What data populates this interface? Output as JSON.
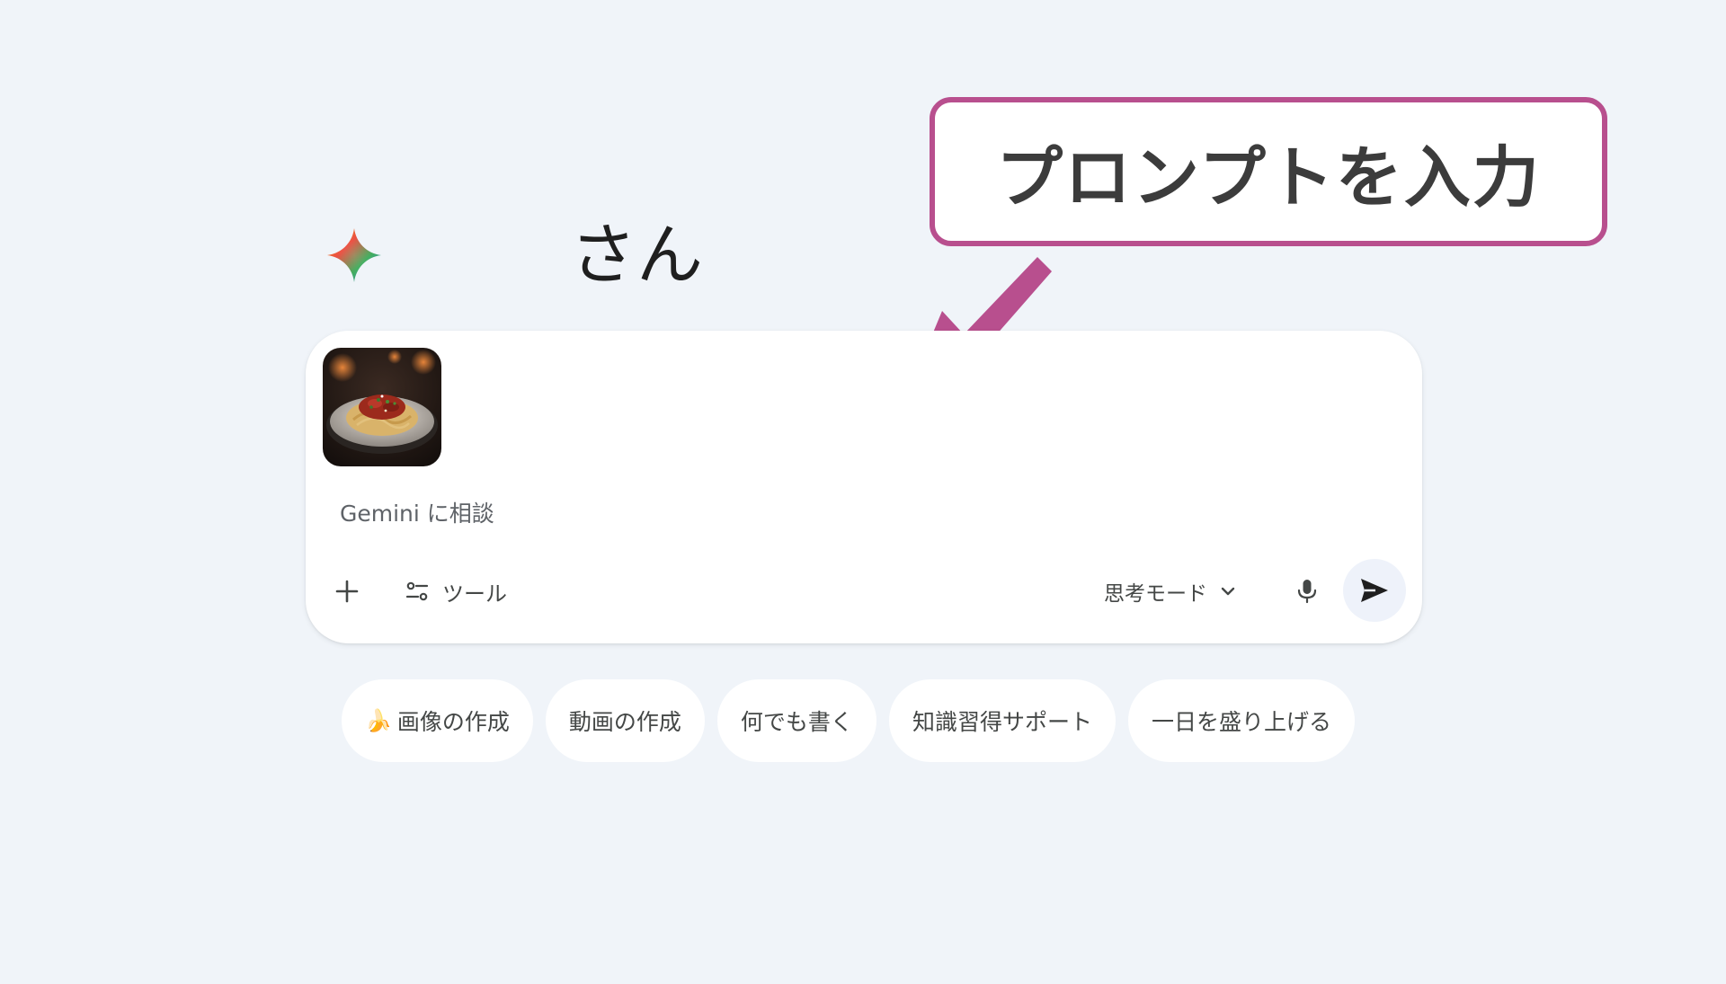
{
  "greeting": {
    "text": "さん"
  },
  "callout": {
    "text": "プロンプトを入力"
  },
  "prompt": {
    "placeholder": "Gemini に相談",
    "tools_label": "ツール",
    "mode_label": "思考モード"
  },
  "chips": [
    {
      "emoji": "🍌",
      "label": "画像の作成"
    },
    {
      "label": "動画の作成"
    },
    {
      "label": "何でも書く"
    },
    {
      "label": "知識習得サポート"
    },
    {
      "label": "一日を盛り上げる"
    }
  ],
  "colors": {
    "background": "#f0f4f9",
    "callout_border": "#b84f8e",
    "arrow": "#b84f8e",
    "card": "#ffffff",
    "send_button_bg": "#eef2fa"
  },
  "icons": {
    "logo": "gemini-sparkle-icon",
    "add": "plus-icon",
    "tools": "tools-sliders-icon",
    "mode_dropdown": "chevron-down-icon",
    "mic": "microphone-icon",
    "send": "send-icon"
  }
}
